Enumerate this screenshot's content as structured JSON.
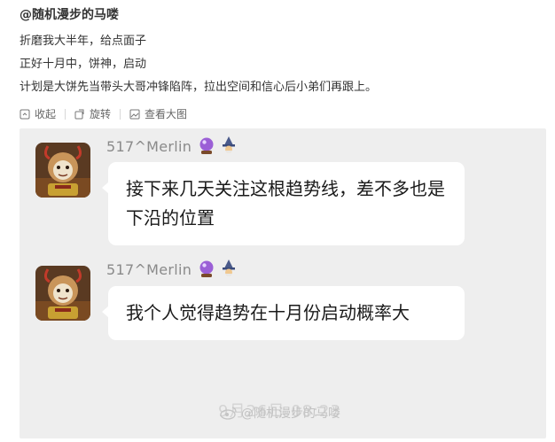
{
  "post": {
    "author": "@随机漫步的马喽",
    "lines": [
      "折磨我大半年，给点面子",
      "正好十月中，饼神，启动",
      "计划是大饼先当带头大哥冲锋陷阵，拉出空间和信心后小弟们再跟上。"
    ]
  },
  "actions": {
    "collapse_label": "收起",
    "rotate_label": "旋转",
    "view_large_label": "查看大图",
    "collapse_icon": "collapse-icon",
    "rotate_icon": "rotate-icon",
    "view_large_icon": "view-large-icon"
  },
  "chat": {
    "messages": [
      {
        "nickname": "517^Merlin",
        "badges": [
          "crystal-ball-icon",
          "wizard-icon"
        ],
        "text": "接下来几天关注这根趋势线，差不多也是下沿的位置"
      },
      {
        "nickname": "517^Merlin",
        "badges": [
          "crystal-ball-icon",
          "wizard-icon"
        ],
        "text": "我个人觉得趋势在十月份启动概率大"
      }
    ],
    "timestamp": "9月26日 08:23",
    "watermark": "@随机漫步的马喽"
  },
  "colors": {
    "panel_bg": "#eeeeee",
    "bubble_bg": "#ffffff",
    "nickname": "#8a8a8a",
    "text": "#1a1a1a"
  }
}
